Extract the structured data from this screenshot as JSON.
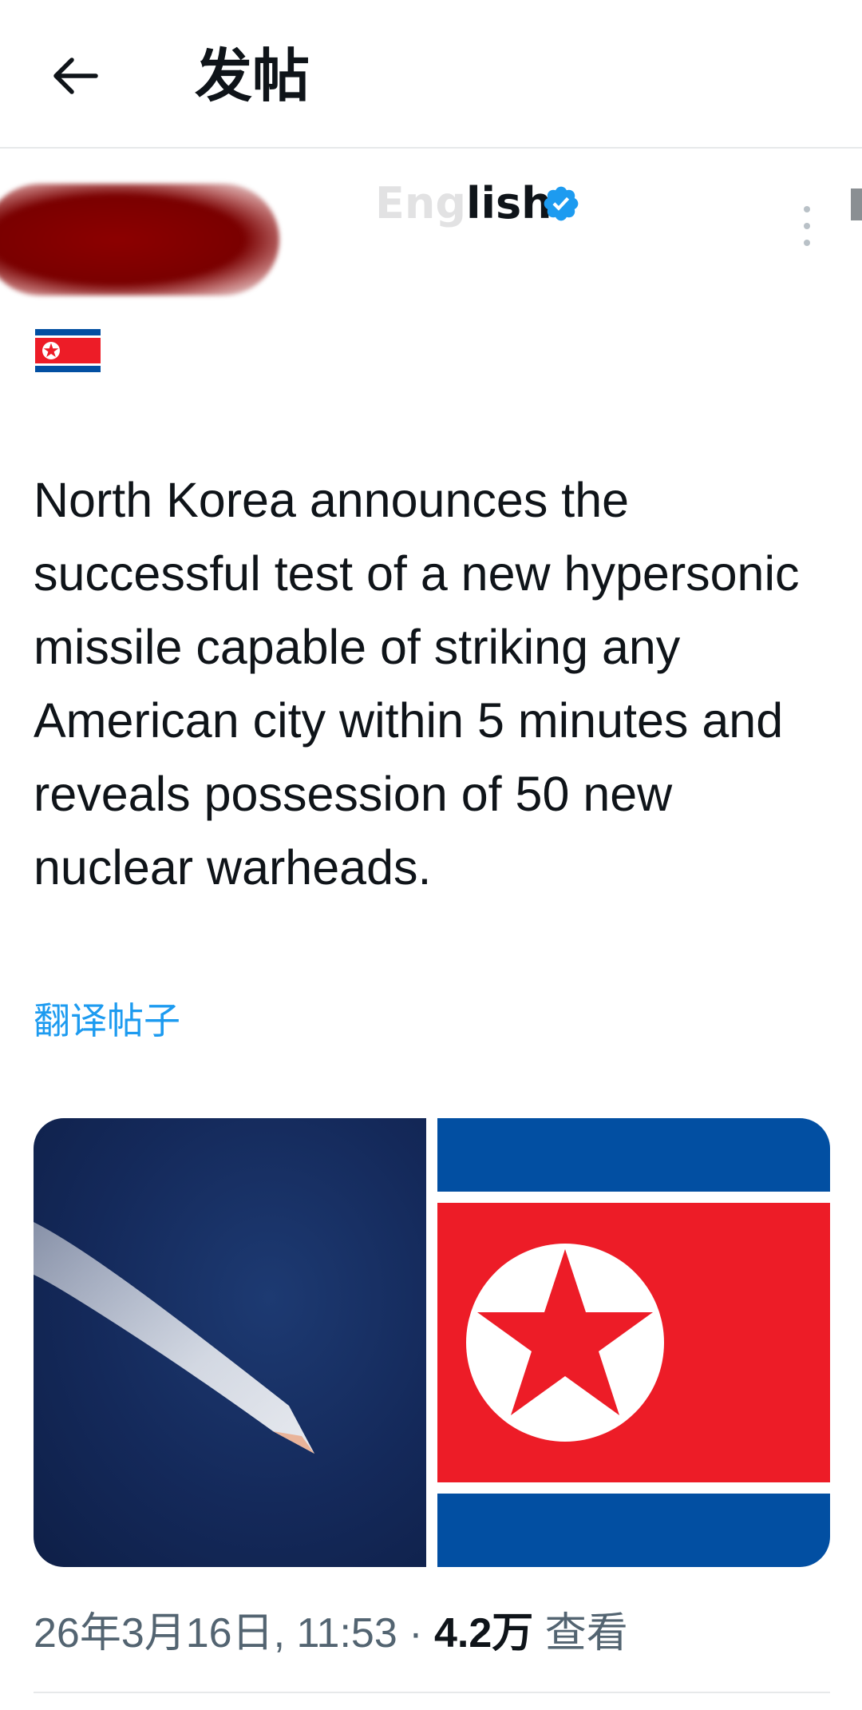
{
  "header": {
    "title": "发帖",
    "back_icon": "arrow-left-icon"
  },
  "author": {
    "name_faded": "Eng",
    "name_visible": "lish",
    "verified_icon": "verified-badge-icon",
    "verified_color": "#1d9bf0",
    "more_icon": "more-vertical-icon",
    "profile_flag_icon": "north-korea-flag-icon"
  },
  "post": {
    "text": "North Korea announces the successful test of a new hypersonic missile capable of striking any American city within 5 minutes and reveals possession of 50 new nuclear warheads.",
    "translate_label": "翻译帖子",
    "link_color": "#1d9bf0"
  },
  "media": {
    "left_image": "missile-contrail-photo",
    "right_image": "north-korea-flag"
  },
  "meta": {
    "timestamp": "26年3月16日, 11:53",
    "separator": "·",
    "views_count": "4.2万",
    "views_label": "查看"
  }
}
